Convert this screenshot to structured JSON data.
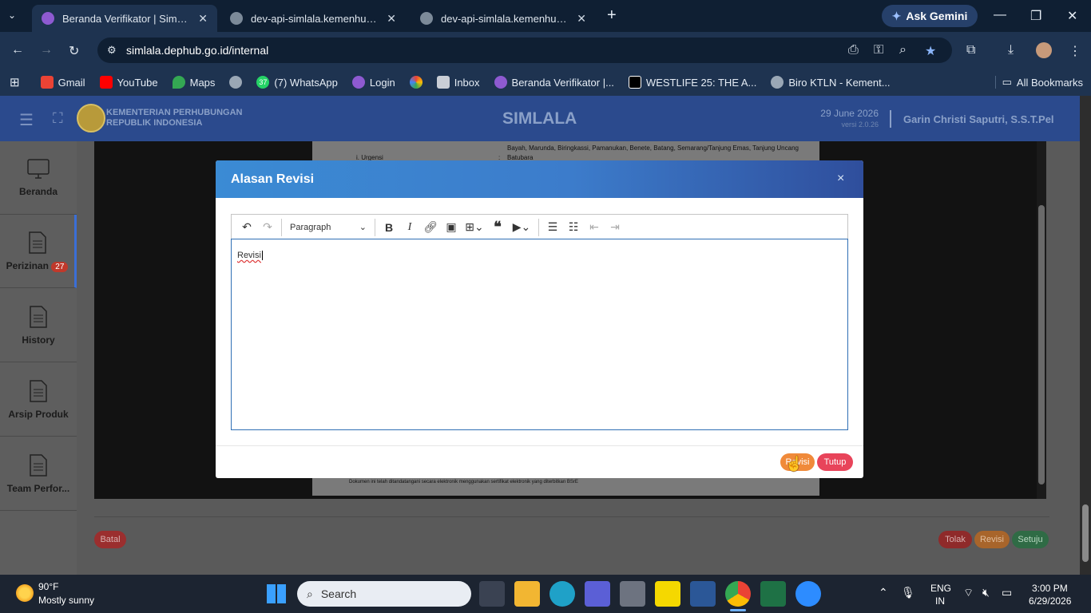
{
  "browser": {
    "tabs": [
      {
        "title": "Beranda Verifikator | SimLala",
        "active": true
      },
      {
        "title": "dev-api-simlala.kemenhub.go.id",
        "active": false
      },
      {
        "title": "dev-api-simlala.kemenhub.go.id",
        "active": false
      }
    ],
    "new_tab": "+",
    "gemini_label": "Ask Gemini",
    "url": "simlala.dephub.go.id/internal",
    "bookmarks": [
      {
        "label": "Gmail",
        "color": "#ea4335"
      },
      {
        "label": "YouTube",
        "color": "#ff0000"
      },
      {
        "label": "Maps",
        "color": "#34a853"
      },
      {
        "label": "",
        "color": "#9aa7b5"
      },
      {
        "label": "(7) WhatsApp",
        "color": "#25d366",
        "badge": "37"
      },
      {
        "label": "Login",
        "color": "#8e5ad1"
      },
      {
        "label": "",
        "color": "#fbbc05"
      },
      {
        "label": "Inbox",
        "color": "#c9ced6"
      },
      {
        "label": "Beranda Verifikator |...",
        "color": "#8e5ad1"
      },
      {
        "label": "WESTLIFE 25: THE A...",
        "color": "#000000"
      },
      {
        "label": "Biro KTLN - Kement...",
        "color": "#9aa7b5"
      }
    ],
    "all_bookmarks": "All Bookmarks"
  },
  "app": {
    "ministry_line1": "KEMENTERIAN PERHUBUNGAN",
    "ministry_line2": "REPUBLIK INDONESIA",
    "app_name": "SIMLALA",
    "date": "29 June 2026",
    "version": "versi 2.0.26",
    "user": "Garin Christi Saputri, S.S.T.Pel",
    "sidebar": [
      {
        "label": "Beranda",
        "icon": "monitor-icon"
      },
      {
        "label": "Perizinan",
        "icon": "document-icon",
        "badge": "27"
      },
      {
        "label": "History",
        "icon": "document-icon"
      },
      {
        "label": "Arsip Produk",
        "icon": "document-icon"
      },
      {
        "label": "Team Perfor...",
        "icon": "document-icon"
      }
    ],
    "doc_text_top": "Bayah, Marunda, Biringkassi, Pamanukan, Benete, Batang, Semarang/Tanjung Emas, Tanjung Uncang",
    "doc_text_top2": "Batubara",
    "doc_item_label": "i.  Urgensi",
    "doc_footer": "Dokumen ini telah ditandatangani secara elektronik menggunakan sertifikat elektronik yang diterbitkan BSrE",
    "actions": {
      "batal": "Batal",
      "tolak": "Tolak",
      "revisi": "Revisi",
      "setuju": "Setuju"
    }
  },
  "modal": {
    "title": "Alasan Revisi",
    "close": "×",
    "paragraph_select": "Paragraph",
    "editor_text": "Revisi",
    "revisi_button": "Revisi",
    "tutup_button": "Tutup"
  },
  "taskbar": {
    "weather_temp": "90°F",
    "weather_desc": "Mostly sunny",
    "search_placeholder": "Search",
    "lang_line1": "ENG",
    "lang_line2": "IN",
    "time": "3:00 PM",
    "date": "6/29/2026"
  },
  "colors": {
    "header_blue": "#2b4a8d",
    "revisi_orange": "#f08a3a",
    "tutup_red": "#e8445a",
    "tolak_red": "#c0392b",
    "setuju_green": "#2e8b57"
  }
}
